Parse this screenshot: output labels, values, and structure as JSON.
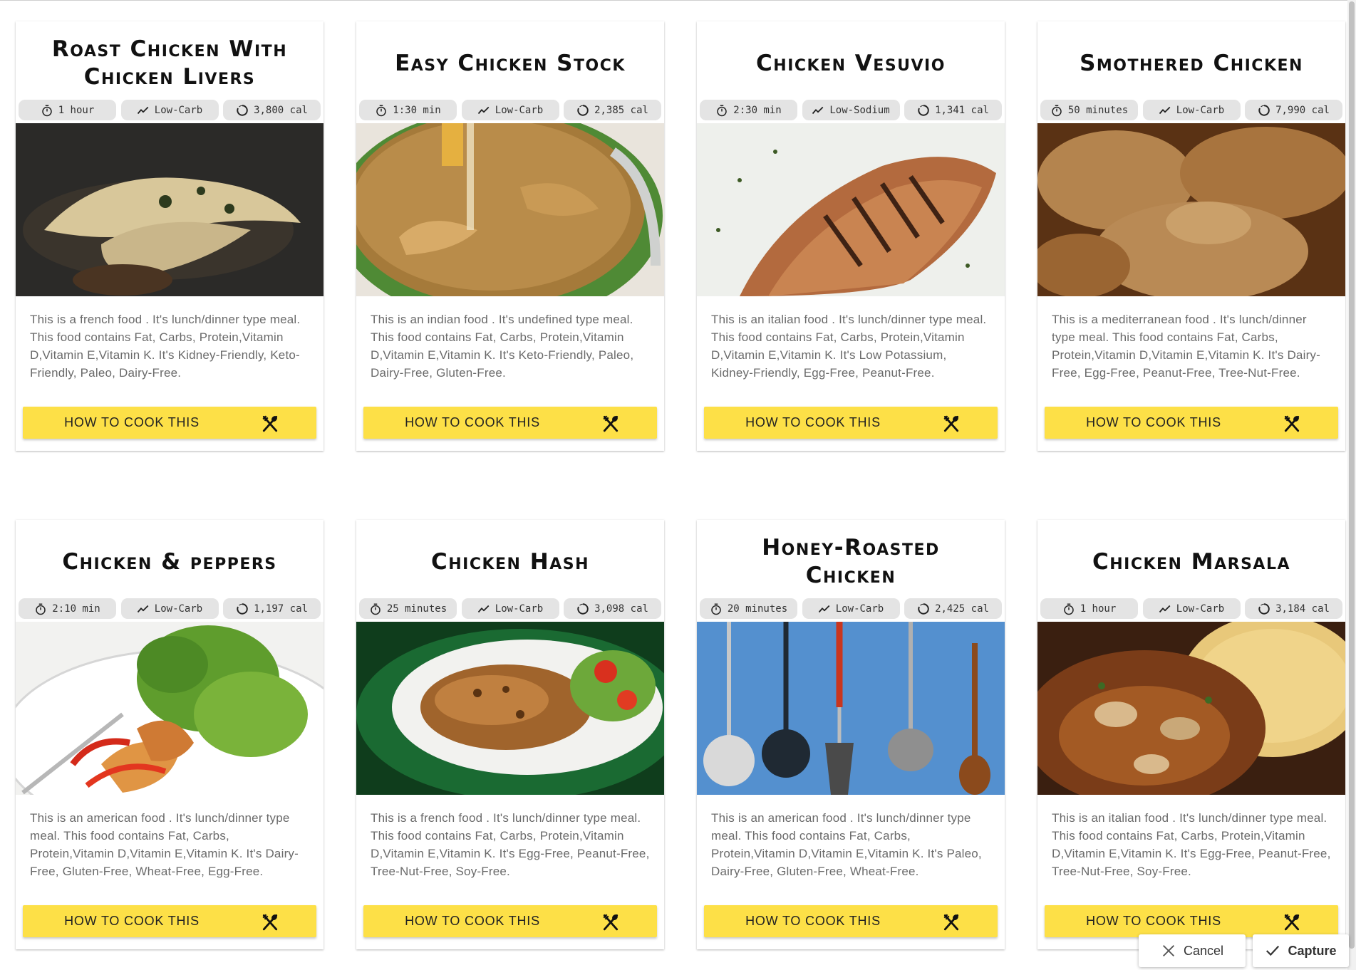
{
  "theme": {
    "button_yellow": "#fde047",
    "chip_bg": "#e4e4e4",
    "text_gray": "#6a6a6a"
  },
  "recipes": [
    {
      "title": "Roast Chicken With Chicken Livers",
      "time": "1 hour",
      "diet": "Low-Carb",
      "calories": "3,800 cal",
      "description": "This is a french food . It's lunch/dinner type meal. This food contains Fat, Carbs, Protein,Vitamin D,Vitamin E,Vitamin K. It's Kidney-Friendly, Keto-Friendly, Paleo, Dairy-Free.",
      "button_label": "HOW TO COOK THIS",
      "image_icon": "roast-chicken-photo"
    },
    {
      "title": "Easy Chicken Stock",
      "time": "1:30 min",
      "diet": "Low-Carb",
      "calories": "2,385 cal",
      "description": "This is an indian food . It's undefined type meal. This food contains Fat, Carbs, Protein,Vitamin D,Vitamin E,Vitamin K. It's Keto-Friendly, Paleo, Dairy-Free, Gluten-Free.",
      "button_label": "HOW TO COOK THIS",
      "image_icon": "stock-pot-photo"
    },
    {
      "title": "Chicken Vesuvio",
      "time": "2:30 min",
      "diet": "Low-Sodium",
      "calories": "1,341 cal",
      "description": "This is an italian food . It's lunch/dinner type meal. This food contains Fat, Carbs, Protein,Vitamin D,Vitamin E,Vitamin K. It's Low Potassium, Kidney-Friendly, Egg-Free, Peanut-Free.",
      "button_label": "HOW TO COOK THIS",
      "image_icon": "grilled-chicken-photo"
    },
    {
      "title": "Smothered Chicken",
      "time": "50 minutes",
      "diet": "Low-Carb",
      "calories": "7,990 cal",
      "description": "This is a mediterranean food . It's lunch/dinner type meal. This food contains Fat, Carbs, Protein,Vitamin D,Vitamin E,Vitamin K. It's Dairy-Free, Egg-Free, Peanut-Free, Tree-Nut-Free.",
      "button_label": "HOW TO COOK THIS",
      "image_icon": "gravy-chicken-photo"
    },
    {
      "title": "Chicken & peppers",
      "time": "2:10 min",
      "diet": "Low-Carb",
      "calories": "1,197 cal",
      "description": "This is an american food . It's lunch/dinner type meal. This food contains Fat, Carbs, Protein,Vitamin D,Vitamin E,Vitamin K. It's Dairy-Free, Gluten-Free, Wheat-Free, Egg-Free.",
      "button_label": "HOW TO COOK THIS",
      "image_icon": "chicken-salad-photo"
    },
    {
      "title": "Chicken Hash",
      "time": "25 minutes",
      "diet": "Low-Carb",
      "calories": "3,098 cal",
      "description": "This is a french food . It's lunch/dinner type meal. This food contains Fat, Carbs, Protein,Vitamin D,Vitamin E,Vitamin K. It's Egg-Free, Peanut-Free, Tree-Nut-Free, Soy-Free.",
      "button_label": "HOW TO COOK THIS",
      "image_icon": "chicken-hash-photo"
    },
    {
      "title": "Honey-Roasted Chicken",
      "time": "20 minutes",
      "diet": "Low-Carb",
      "calories": "2,425 cal",
      "description": "This is an american food . It's lunch/dinner type meal. This food contains Fat, Carbs, Protein,Vitamin D,Vitamin E,Vitamin K. It's Paleo, Dairy-Free, Gluten-Free, Wheat-Free.",
      "button_label": "HOW TO COOK THIS",
      "image_icon": "kitchen-utensils-photo"
    },
    {
      "title": "Chicken Marsala",
      "time": "1 hour",
      "diet": "Low-Carb",
      "calories": "3,184 cal",
      "description": "This is an italian food . It's lunch/dinner type meal. This food contains Fat, Carbs, Protein,Vitamin D,Vitamin E,Vitamin K. It's Egg-Free, Peanut-Free, Tree-Nut-Free, Soy-Free.",
      "button_label": "HOW TO COOK THIS",
      "image_icon": "chicken-marsala-photo"
    }
  ],
  "actions": {
    "cancel_label": "Cancel",
    "capture_label": "Capture"
  }
}
